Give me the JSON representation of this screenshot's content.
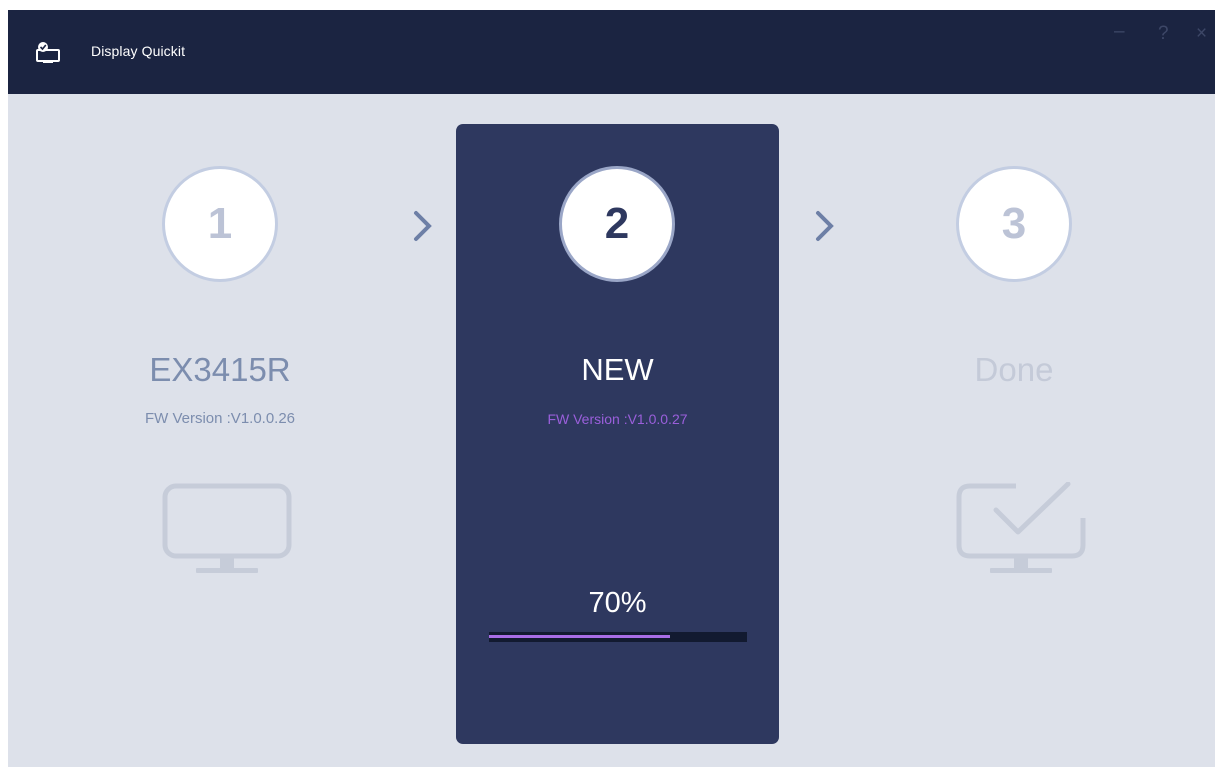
{
  "window": {
    "title": "Display Quickit",
    "controls": {
      "minimize": "–",
      "help": "?",
      "close": "×"
    },
    "icon": "display-quickit-app-icon"
  },
  "steps": [
    {
      "number": "1",
      "name": "EX3415R",
      "fw_version": "FW Version :V1.0.0.26",
      "icon": "monitor-icon",
      "state": "completed"
    },
    {
      "number": "2",
      "name": "NEW",
      "fw_version": "FW Version :V1.0.0.27",
      "state": "active"
    },
    {
      "number": "3",
      "name": "Done",
      "icon": "monitor-check-icon",
      "state": "pending"
    }
  ],
  "progress": {
    "label": "70%",
    "value": 0.7
  },
  "colors": {
    "titlebar": "#1b2441",
    "background": "#dde1ea",
    "active_card": "#2e385f",
    "accent_purple": "#a86de6",
    "fw_version_active": "#9a5fdb"
  }
}
